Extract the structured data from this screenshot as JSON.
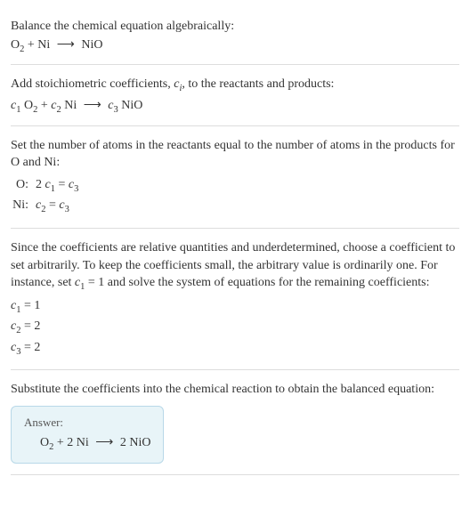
{
  "section1": {
    "intro": "Balance the chemical equation algebraically:",
    "eq": "O₂ + Ni ⟶ NiO"
  },
  "section2": {
    "intro_a": "Add stoichiometric coefficients, ",
    "intro_ci": "c",
    "intro_ci_sub": "i",
    "intro_b": ", to the reactants and products:",
    "eq_c1": "c",
    "eq_c1_sub": "1",
    "eq_sp1": " O",
    "eq_o2_sub": "2",
    "eq_plus": " + ",
    "eq_c2": "c",
    "eq_c2_sub": "2",
    "eq_ni": " Ni ⟶ ",
    "eq_c3": "c",
    "eq_c3_sub": "3",
    "eq_nio": " NiO"
  },
  "section3": {
    "intro": "Set the number of atoms in the reactants equal to the number of atoms in the products for O and Ni:",
    "rows": [
      {
        "label": "O:",
        "lhs_pre": "2 ",
        "lhs_c": "c",
        "lhs_sub": "1",
        "eq": " = ",
        "rhs_c": "c",
        "rhs_sub": "3"
      },
      {
        "label": "Ni:",
        "lhs_pre": "",
        "lhs_c": "c",
        "lhs_sub": "2",
        "eq": " = ",
        "rhs_c": "c",
        "rhs_sub": "3"
      }
    ]
  },
  "section4": {
    "intro_a": "Since the coefficients are relative quantities and underdetermined, choose a coefficient to set arbitrarily. To keep the coefficients small, the arbitrary value is ordinarily one. For instance, set ",
    "intro_c": "c",
    "intro_c_sub": "1",
    "intro_b": " = 1 and solve the system of equations for the remaining coefficients:",
    "coeffs": [
      {
        "c": "c",
        "sub": "1",
        "val": " = 1"
      },
      {
        "c": "c",
        "sub": "2",
        "val": " = 2"
      },
      {
        "c": "c",
        "sub": "3",
        "val": " = 2"
      }
    ]
  },
  "section5": {
    "intro": "Substitute the coefficients into the chemical reaction to obtain the balanced equation:",
    "answer_label": "Answer:",
    "answer_eq_a": "O",
    "answer_eq_sub": "2",
    "answer_eq_b": " + 2 Ni ⟶ 2 NiO"
  },
  "chart_data": {
    "type": "table",
    "title": "Chemical equation balancing",
    "unbalanced": "O2 + Ni -> NiO",
    "coefficients": {
      "c1": 1,
      "c2": 2,
      "c3": 2
    },
    "balanced": "O2 + 2 Ni -> 2 NiO",
    "atom_balance": [
      {
        "element": "O",
        "equation": "2 c1 = c3"
      },
      {
        "element": "Ni",
        "equation": "c2 = c3"
      }
    ]
  }
}
